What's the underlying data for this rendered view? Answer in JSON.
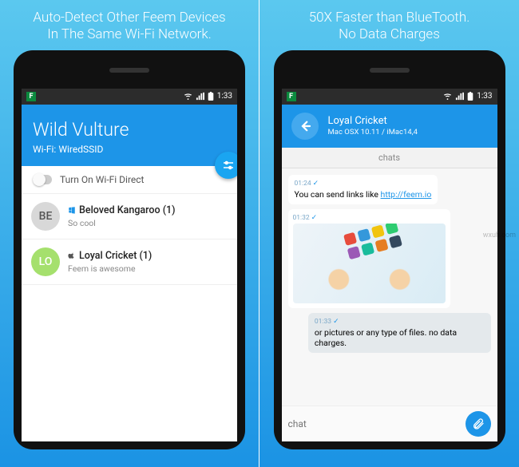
{
  "watermark": "wxuh.com",
  "left": {
    "caption_l1": "Auto-Detect Other Feem Devices",
    "caption_l2": "In The Same Wi-Fi Network.",
    "statusbar": {
      "app_letter": "F",
      "time": "1:33",
      "icons": [
        "wifi",
        "signal",
        "battery"
      ]
    },
    "appbar": {
      "title": "Wild Vulture",
      "sub_prefix": "Wi-Fi: ",
      "sub_value": "WiredSSID"
    },
    "wifi_direct_label": "Turn On Wi-Fi Direct",
    "devices": [
      {
        "initials": "BE",
        "avatar_class": "avatar-be",
        "os": "windows",
        "name": "Beloved Kangaroo (1)",
        "sub": "So cool"
      },
      {
        "initials": "LO",
        "avatar_class": "avatar-lo",
        "os": "apple",
        "name": "Loyal Cricket (1)",
        "sub": "Feem is awesome"
      }
    ]
  },
  "right": {
    "caption_l1": "50X Faster than BlueTooth.",
    "caption_l2": "No Data Charges",
    "statusbar": {
      "app_letter": "F",
      "time": "1:33",
      "icons": [
        "wifi",
        "signal",
        "battery"
      ]
    },
    "header": {
      "title": "Loyal Cricket",
      "subtitle": "Mac OSX 10.11 / iMac14,4"
    },
    "tab_label": "chats",
    "messages": {
      "m1_ts": "01:24",
      "m1_prefix": "You can send links like ",
      "m1_link": "http://feem.io",
      "m2_ts": "01:32",
      "m3_ts": "01:33",
      "m3_text": "or pictures or any type of files. no data charges."
    },
    "input": {
      "placeholder": "chat"
    }
  },
  "colors": {
    "accent": "#1D95E8"
  }
}
